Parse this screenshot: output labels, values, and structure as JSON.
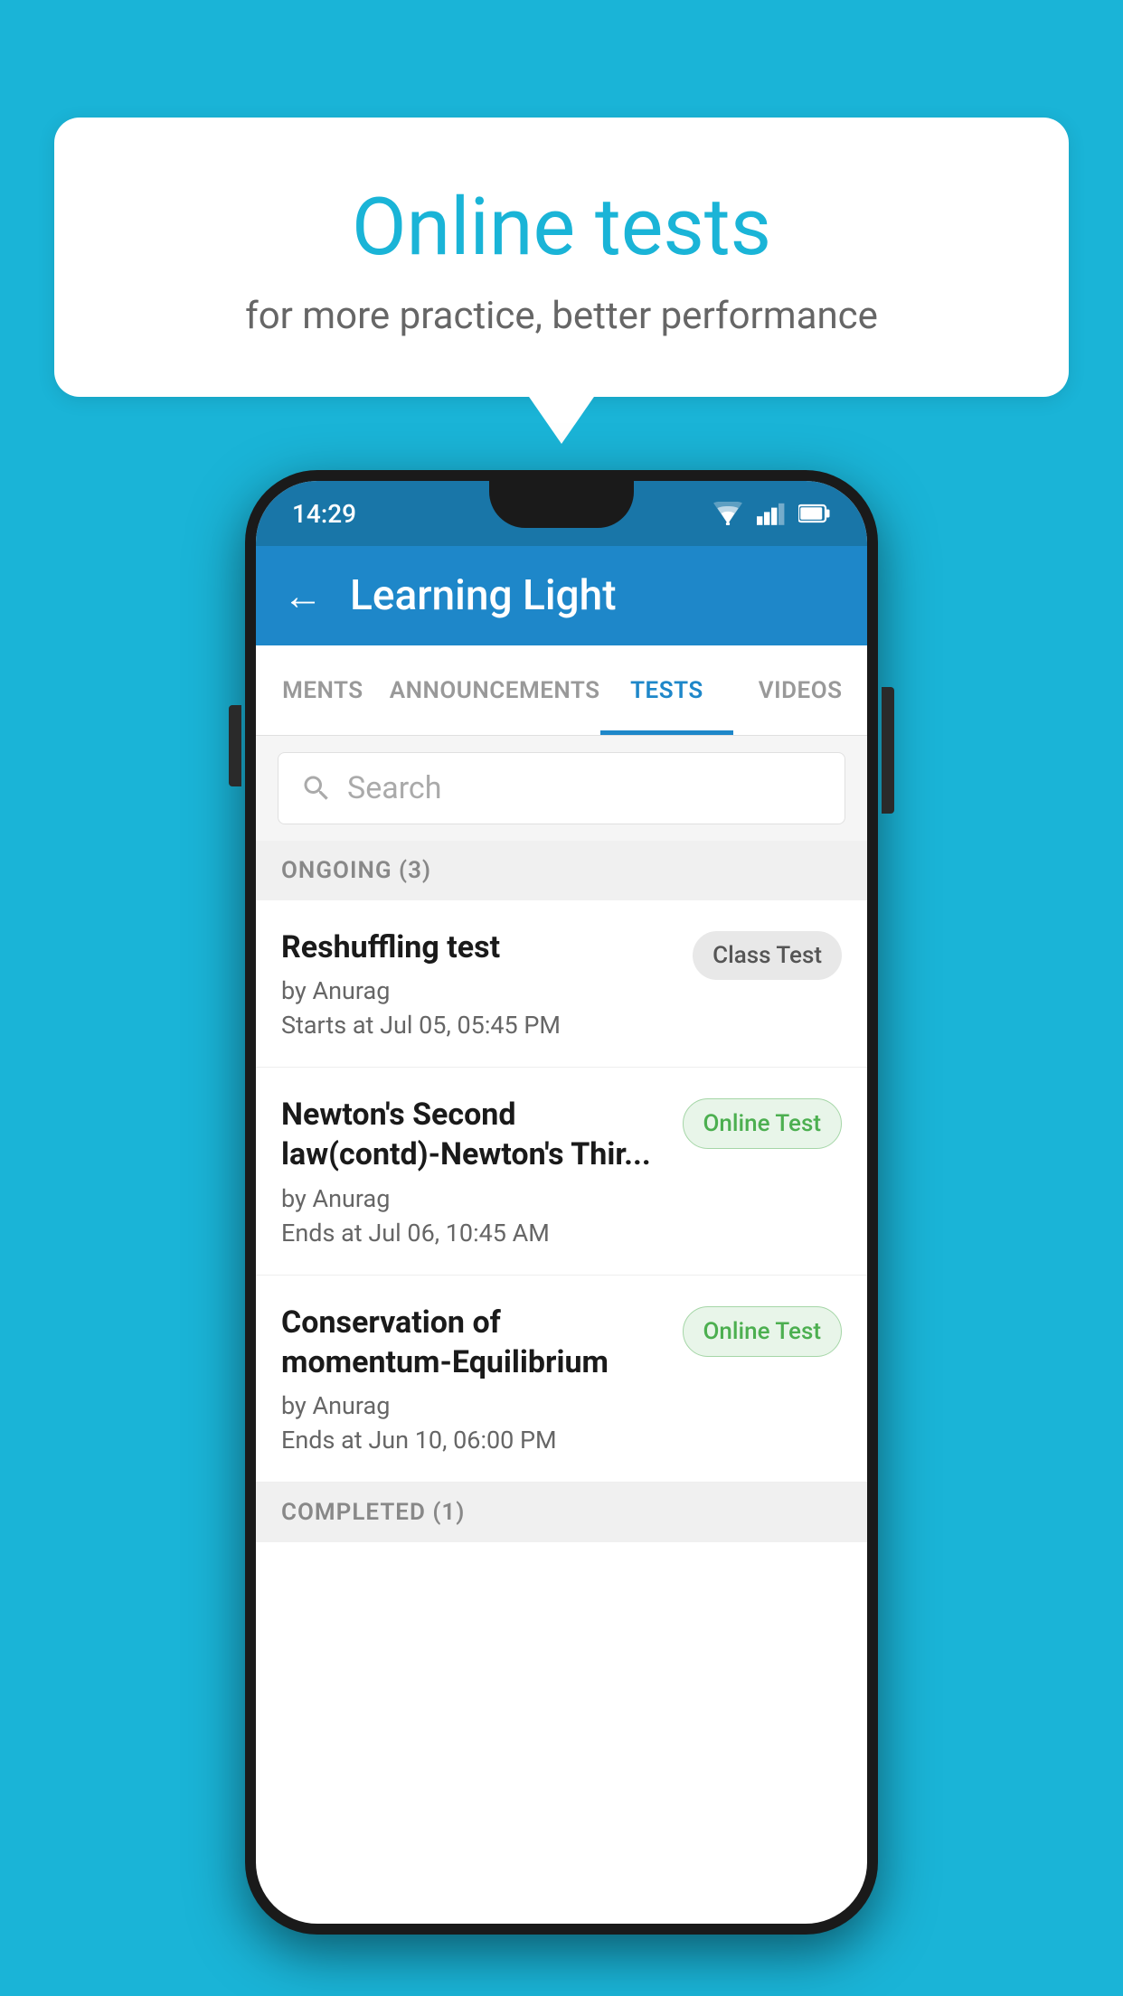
{
  "background_color": "#1ab4d7",
  "speech_bubble": {
    "title": "Online tests",
    "subtitle": "for more practice, better performance"
  },
  "phone": {
    "status_bar": {
      "time": "14:29",
      "signal": "wifi+cell+battery"
    },
    "app_bar": {
      "back_label": "←",
      "title": "Learning Light"
    },
    "tabs": [
      {
        "label": "MENTS",
        "active": false
      },
      {
        "label": "ANNOUNCEMENTS",
        "active": false
      },
      {
        "label": "TESTS",
        "active": true
      },
      {
        "label": "VIDEOS",
        "active": false
      }
    ],
    "search": {
      "placeholder": "Search"
    },
    "ongoing_section": {
      "header": "ONGOING (3)",
      "items": [
        {
          "name": "Reshuffling test",
          "author": "by Anurag",
          "time_label": "Starts at",
          "time": "Jul 05, 05:45 PM",
          "badge": "Class Test",
          "badge_type": "class"
        },
        {
          "name": "Newton's Second law(contd)-Newton's Thir...",
          "author": "by Anurag",
          "time_label": "Ends at",
          "time": "Jul 06, 10:45 AM",
          "badge": "Online Test",
          "badge_type": "online"
        },
        {
          "name": "Conservation of momentum-Equilibrium",
          "author": "by Anurag",
          "time_label": "Ends at",
          "time": "Jun 10, 06:00 PM",
          "badge": "Online Test",
          "badge_type": "online"
        }
      ]
    },
    "completed_section": {
      "header": "COMPLETED (1)"
    }
  }
}
